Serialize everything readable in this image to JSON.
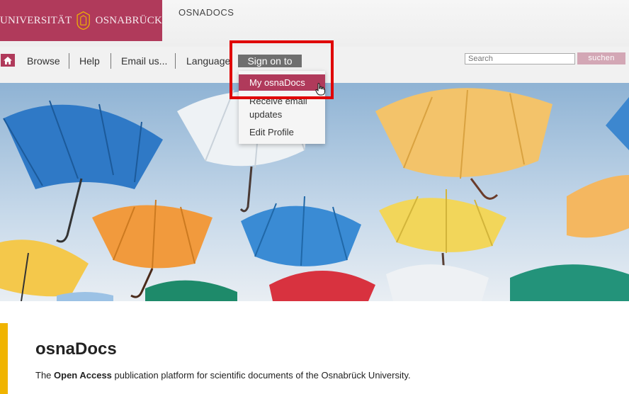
{
  "header": {
    "logo_left": "UNIVERSITÄT",
    "logo_right": "OSNABRÜCK",
    "site_name": "OSNADOCS"
  },
  "nav": {
    "items": [
      {
        "label": "Browse"
      },
      {
        "label": "Help"
      },
      {
        "label": "Email us..."
      },
      {
        "label": "Language"
      }
    ],
    "sign_on": "Sign on to",
    "search_placeholder": "Search",
    "search_button": "suchen"
  },
  "dropdown": {
    "items": [
      {
        "label": "My osnaDocs",
        "active": true
      },
      {
        "label": "Receive email updates"
      },
      {
        "label": "Edit Profile"
      }
    ]
  },
  "main": {
    "title": "osnaDocs",
    "desc_prefix": "The ",
    "desc_bold": "Open Access",
    "desc_suffix": " publication platform for scientific documents of the Osnabrück University."
  },
  "colors": {
    "brand": "#b03a5b",
    "accent": "#f0b400",
    "highlight": "#e00000"
  }
}
